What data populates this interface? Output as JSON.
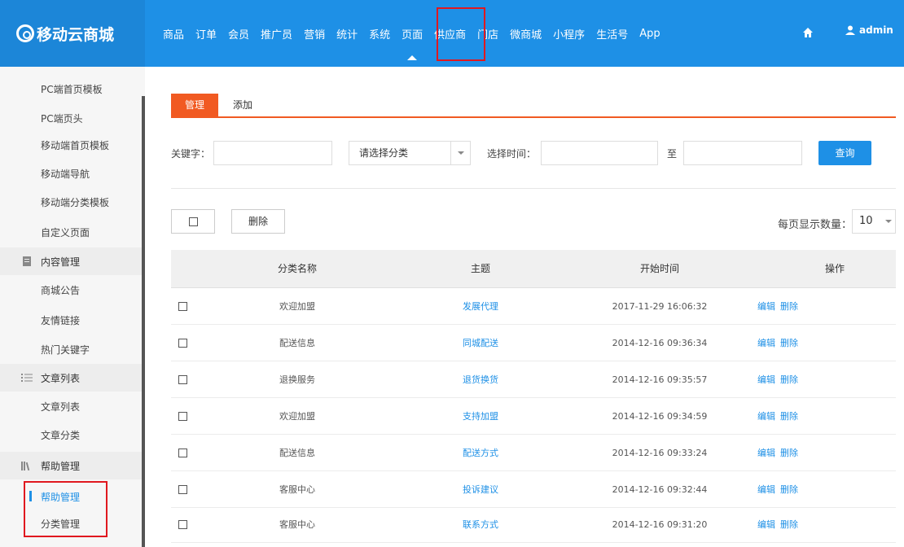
{
  "app": {
    "logo_text": "移动云商城"
  },
  "nav": [
    "商品",
    "订单",
    "会员",
    "推广员",
    "营销",
    "统计",
    "系统",
    "页面",
    "供应商",
    "门店",
    "微商城",
    "小程序",
    "生活号",
    "App"
  ],
  "nav_active": "页面",
  "user": {
    "name": "admin"
  },
  "sidebar": {
    "top_items": [
      "PC端首页模板",
      "PC端页头",
      "移动端首页模板",
      "移动端导航",
      "移动端分类模板",
      "自定义页面"
    ],
    "content_group": "内容管理",
    "content_items": [
      "商城公告",
      "友情链接",
      "热门关键字"
    ],
    "article_group": "文章列表",
    "article_items": [
      "文章列表",
      "文章分类"
    ],
    "help_group": "帮助管理",
    "help_items": [
      "帮助管理",
      "分类管理"
    ]
  },
  "tabs": {
    "manage": "管理",
    "add": "添加"
  },
  "filters": {
    "keyword_label": "关键字：",
    "category_placeholder": "请选择分类",
    "time_label": "选择时间：",
    "to_label": "至",
    "search_button": "查询"
  },
  "toolbar": {
    "delete_button": "删除",
    "page_size_label": "每页显示数量：",
    "page_size_value": "10"
  },
  "table": {
    "headers": [
      "分类名称",
      "主题",
      "开始时间",
      "操作"
    ],
    "rows": [
      {
        "category": "欢迎加盟",
        "topic": "发展代理",
        "time": "2017-11-29 16:06:32",
        "edit": "编辑",
        "delete": "删除"
      },
      {
        "category": "配送信息",
        "topic": "同城配送",
        "time": "2014-12-16 09:36:34",
        "edit": "编辑",
        "delete": "删除"
      },
      {
        "category": "退换服务",
        "topic": "退货换货",
        "time": "2014-12-16 09:35:57",
        "edit": "编辑",
        "delete": "删除"
      },
      {
        "category": "欢迎加盟",
        "topic": "支持加盟",
        "time": "2014-12-16 09:34:59",
        "edit": "编辑",
        "delete": "删除"
      },
      {
        "category": "配送信息",
        "topic": "配送方式",
        "time": "2014-12-16 09:33:24",
        "edit": "编辑",
        "delete": "删除"
      },
      {
        "category": "客服中心",
        "topic": "投诉建议",
        "time": "2014-12-16 09:32:44",
        "edit": "编辑",
        "delete": "删除"
      },
      {
        "category": "客服中心",
        "topic": "联系方式",
        "time": "2014-12-16 09:31:20",
        "edit": "编辑",
        "delete": "删除"
      }
    ]
  },
  "colors": {
    "primary": "#1e90e6",
    "accent": "#f15a22",
    "highlight": "#e0181f"
  }
}
